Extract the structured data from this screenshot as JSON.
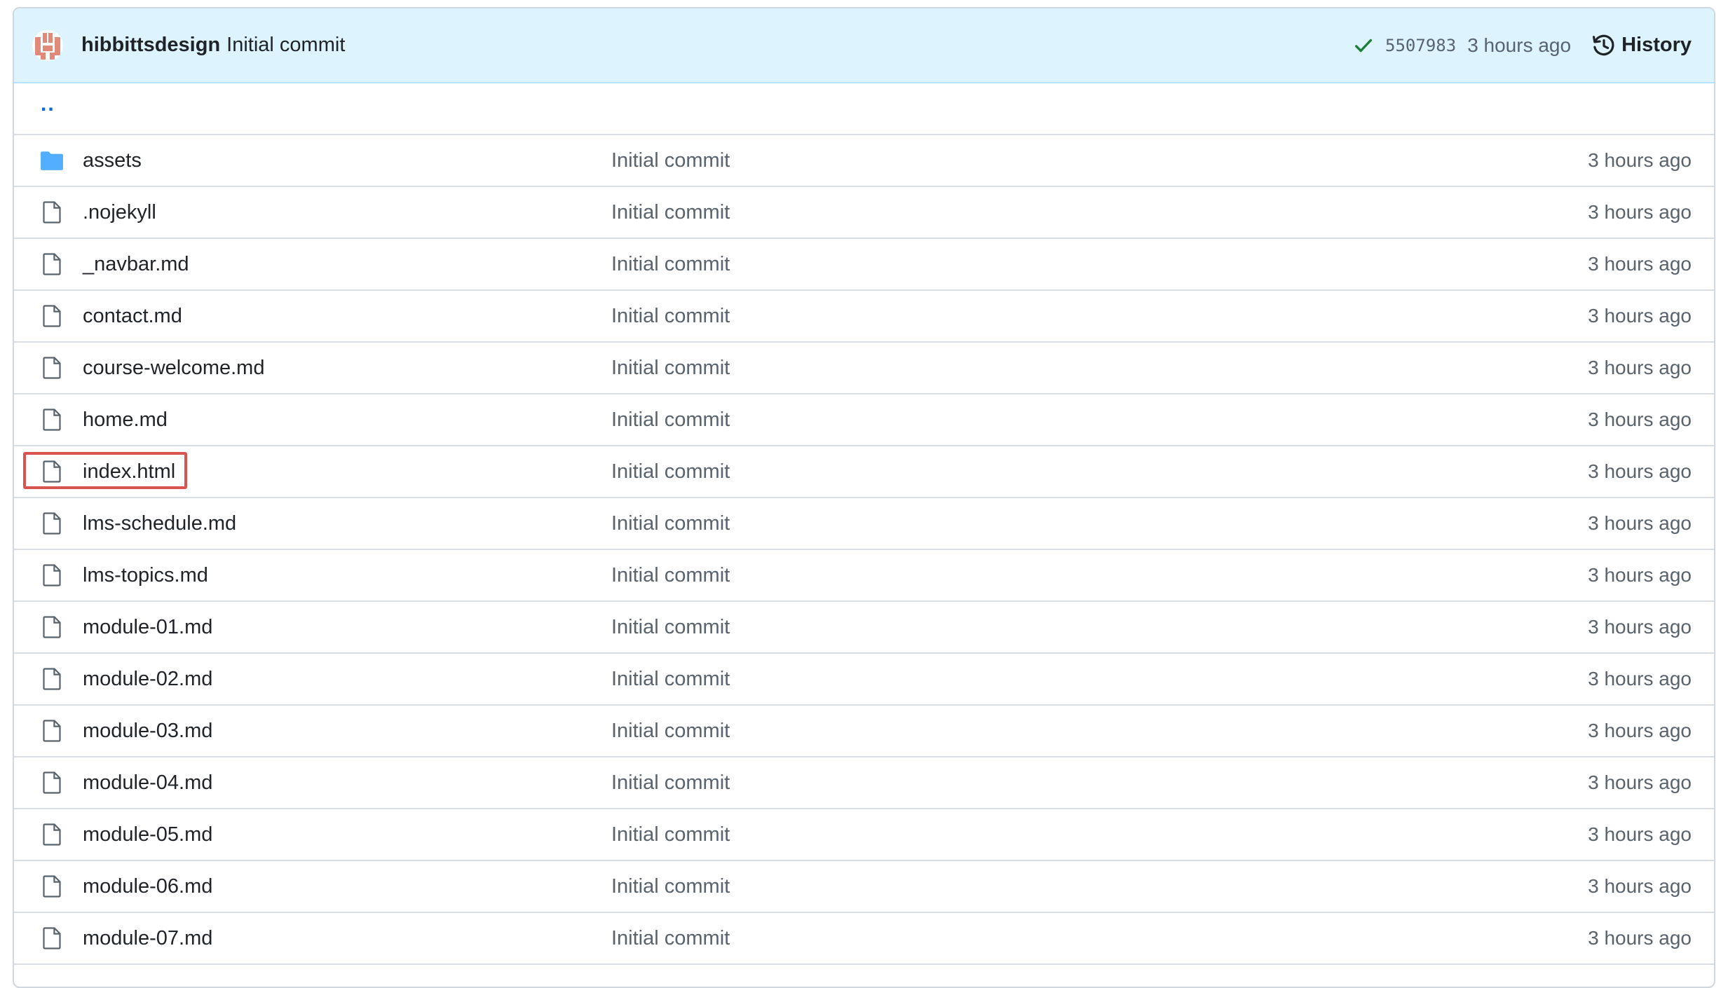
{
  "commit": {
    "author": "hibbittsdesign",
    "message": "Initial commit",
    "sha": "5507983",
    "time": "3 hours ago",
    "history_label": "History"
  },
  "parent_dir": "..",
  "files": [
    {
      "name": "assets",
      "type": "folder",
      "message": "Initial commit",
      "age": "3 hours ago"
    },
    {
      "name": ".nojekyll",
      "type": "file",
      "message": "Initial commit",
      "age": "3 hours ago"
    },
    {
      "name": "_navbar.md",
      "type": "file",
      "message": "Initial commit",
      "age": "3 hours ago"
    },
    {
      "name": "contact.md",
      "type": "file",
      "message": "Initial commit",
      "age": "3 hours ago"
    },
    {
      "name": "course-welcome.md",
      "type": "file",
      "message": "Initial commit",
      "age": "3 hours ago"
    },
    {
      "name": "home.md",
      "type": "file",
      "message": "Initial commit",
      "age": "3 hours ago"
    },
    {
      "name": "index.html",
      "type": "file",
      "message": "Initial commit",
      "age": "3 hours ago",
      "highlighted": true
    },
    {
      "name": "lms-schedule.md",
      "type": "file",
      "message": "Initial commit",
      "age": "3 hours ago"
    },
    {
      "name": "lms-topics.md",
      "type": "file",
      "message": "Initial commit",
      "age": "3 hours ago"
    },
    {
      "name": "module-01.md",
      "type": "file",
      "message": "Initial commit",
      "age": "3 hours ago"
    },
    {
      "name": "module-02.md",
      "type": "file",
      "message": "Initial commit",
      "age": "3 hours ago"
    },
    {
      "name": "module-03.md",
      "type": "file",
      "message": "Initial commit",
      "age": "3 hours ago"
    },
    {
      "name": "module-04.md",
      "type": "file",
      "message": "Initial commit",
      "age": "3 hours ago"
    },
    {
      "name": "module-05.md",
      "type": "file",
      "message": "Initial commit",
      "age": "3 hours ago"
    },
    {
      "name": "module-06.md",
      "type": "file",
      "message": "Initial commit",
      "age": "3 hours ago"
    },
    {
      "name": "module-07.md",
      "type": "file",
      "message": "Initial commit",
      "age": "3 hours ago"
    }
  ],
  "colors": {
    "header_bg": "#ddf4ff",
    "link_blue": "#0969da",
    "folder_blue": "#54aeff",
    "success_green": "#1a7f37",
    "highlight_red": "#d9534f"
  }
}
